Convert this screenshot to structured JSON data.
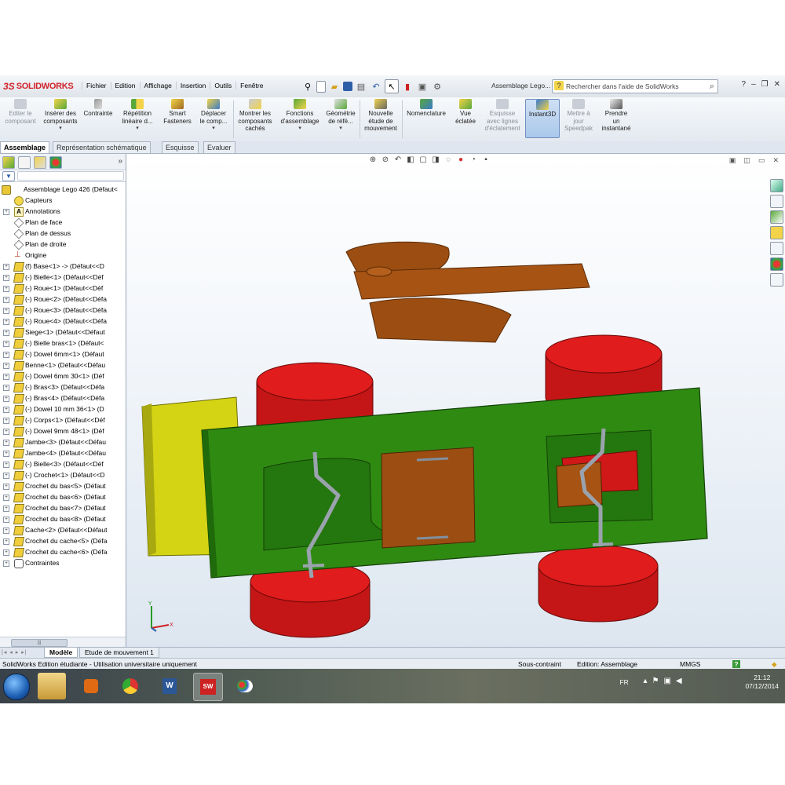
{
  "title_bar": {
    "logo_mark": "3S",
    "logo_text": "SOLIDWORKS",
    "menus": [
      "Fichier",
      "Edition",
      "Affichage",
      "Insertion",
      "Outils",
      "Fenêtre"
    ],
    "document_title": "Assemblage Lego...",
    "search_placeholder": "Rechercher dans l'aide de SolidWorks"
  },
  "toolbar": {
    "edit_component": [
      "Editer le",
      "composant"
    ],
    "insert_components": [
      "Insérer des",
      "composants"
    ],
    "mate": [
      "Contrainte"
    ],
    "linear_pattern": [
      "Répétition",
      "linéaire d..."
    ],
    "smart_fasteners": [
      "Smart",
      "Fasteners"
    ],
    "move_component": [
      "Déplacer",
      "le comp..."
    ],
    "show_hidden": [
      "Montrer les",
      "composants",
      "cachés"
    ],
    "assembly_features": [
      "Fonctions",
      "d'assemblage"
    ],
    "reference_geometry": [
      "Géométrie",
      "de réfé..."
    ],
    "new_motion_study": [
      "Nouvelle",
      "étude de",
      "mouvement"
    ],
    "bom": [
      "Nomenclature"
    ],
    "exploded_view": [
      "Vue",
      "éclatée"
    ],
    "explode_line_sketch": [
      "Esquisse",
      "avec lignes",
      "d'éclatement"
    ],
    "instant3d": [
      "Instant3D"
    ],
    "update_speedpak": [
      "Mettre à",
      "jour",
      "Speedpak"
    ],
    "take_snapshot": [
      "Prendre",
      "un",
      "instantané"
    ]
  },
  "command_tabs": [
    "Assemblage",
    "Représentation schématique",
    "Esquisse",
    "Evaluer"
  ],
  "feature_tree": {
    "root": "Assemblage Lego 426  (Défaut<",
    "items": [
      {
        "label": "Capteurs",
        "icon": "sensor-icon"
      },
      {
        "label": "Annotations",
        "icon": "annotation-icon"
      },
      {
        "label": "Plan de face",
        "icon": "plane-icon"
      },
      {
        "label": "Plan de dessus",
        "icon": "plane-icon"
      },
      {
        "label": "Plan de droite",
        "icon": "plane-icon"
      },
      {
        "label": "Origine",
        "icon": "origin-icon"
      },
      {
        "label": "(f) Base<1> -> (Défaut<<D",
        "icon": "part-icon"
      },
      {
        "label": "(-) Bielle<1> (Défaut<<Déf",
        "icon": "part-icon"
      },
      {
        "label": "(-) Roue<1> (Défaut<<Déf",
        "icon": "part-icon"
      },
      {
        "label": "(-) Roue<2> (Défaut<<Défa",
        "icon": "part-icon"
      },
      {
        "label": "(-) Roue<3> (Défaut<<Défa",
        "icon": "part-icon"
      },
      {
        "label": "(-) Roue<4> (Défaut<<Défa",
        "icon": "part-icon"
      },
      {
        "label": "Siege<1> (Défaut<<Défaut",
        "icon": "part-icon"
      },
      {
        "label": "(-) Bielle bras<1> (Défaut<",
        "icon": "part-icon"
      },
      {
        "label": "(-) Dowel 6mm<1> (Défaut",
        "icon": "part-icon"
      },
      {
        "label": "Benne<1> (Défaut<<Défau",
        "icon": "part-icon"
      },
      {
        "label": "(-) Dowel 6mm 30<1> (Déf",
        "icon": "part-icon"
      },
      {
        "label": "(-) Bras<3> (Défaut<<Défa",
        "icon": "part-icon"
      },
      {
        "label": "(-) Bras<4> (Défaut<<Défa",
        "icon": "part-icon"
      },
      {
        "label": "(-) Dowel 10 mm 36<1> (D",
        "icon": "part-icon"
      },
      {
        "label": "(-) Corps<1> (Défaut<<Déf",
        "icon": "part-icon"
      },
      {
        "label": "(-) Dowel 9mm 48<1> (Déf",
        "icon": "part-icon"
      },
      {
        "label": "Jambe<3> (Défaut<<Défau",
        "icon": "part-icon"
      },
      {
        "label": "Jambe<4> (Défaut<<Défau",
        "icon": "part-icon"
      },
      {
        "label": "(-) Bielle<3> (Défaut<<Déf",
        "icon": "part-icon"
      },
      {
        "label": "(-) Crochet<1> (Défaut<<D",
        "icon": "part-icon"
      },
      {
        "label": "Crochet du bas<5> (Défaut",
        "icon": "part-icon"
      },
      {
        "label": "Crochet du bas<6> (Défaut",
        "icon": "part-icon"
      },
      {
        "label": "Crochet du bas<7> (Défaut",
        "icon": "part-icon"
      },
      {
        "label": "Crochet du bas<8> (Défaut",
        "icon": "part-icon"
      },
      {
        "label": "Cache<2> (Défaut<<Défaut",
        "icon": "part-icon"
      },
      {
        "label": "Crochet du cache<5> (Défa",
        "icon": "part-icon"
      },
      {
        "label": "Crochet du cache<6> (Défa",
        "icon": "part-icon"
      },
      {
        "label": "Contraintes",
        "icon": "mates-icon"
      }
    ]
  },
  "bottom_tabs": [
    "Modèle",
    "Etude de mouvement 1"
  ],
  "status_bar": {
    "left": "SolidWorks Edition étudiante - Utilisation universitaire uniquement",
    "state": "Sous-contraint",
    "mode": "Edition: Assemblage",
    "units": "MMGS",
    "help": "?"
  },
  "taskbar": {
    "language": "FR",
    "time": "21:12",
    "date": "07/12/2014"
  },
  "colors": {
    "frame_green": "#2f8a12",
    "wheel_red": "#d01818",
    "bucket_brown": "#9c4e12",
    "seat_yellow": "#d0d010",
    "viewport_top": "#ffffff",
    "viewport_bottom": "#dde6f0"
  }
}
